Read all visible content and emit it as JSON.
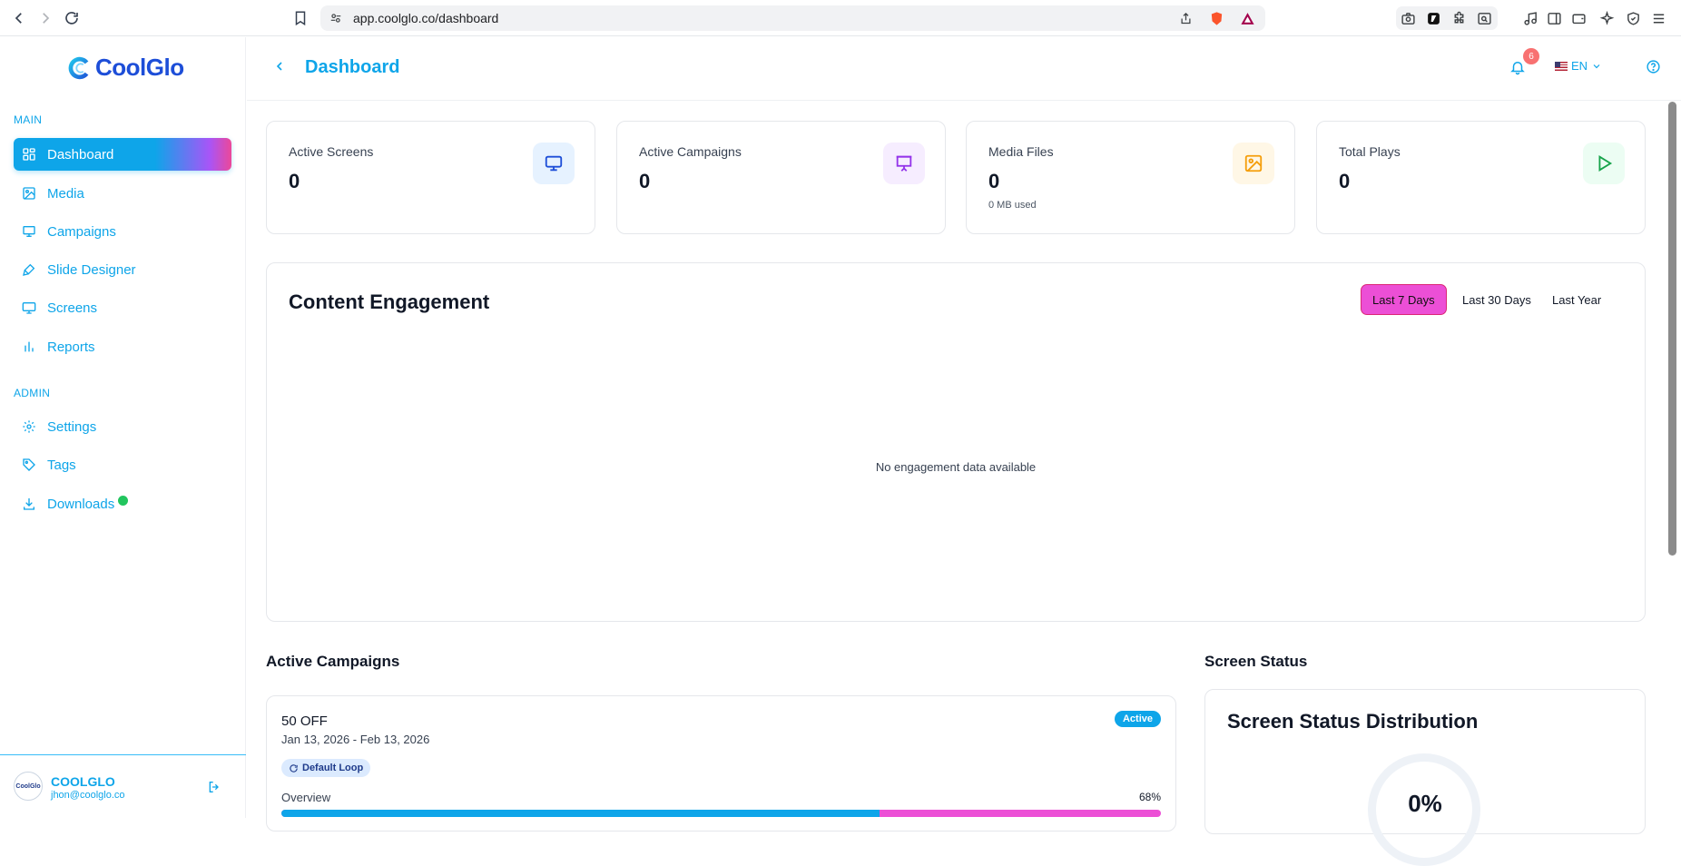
{
  "browser": {
    "url": "app.coolglo.co/dashboard"
  },
  "brand": {
    "name": "CoolGlo"
  },
  "header": {
    "title": "Dashboard",
    "notification_count": "6",
    "language": "EN"
  },
  "sidebar": {
    "main_label": "MAIN",
    "admin_label": "ADMIN",
    "main_items": [
      {
        "label": "Dashboard",
        "icon": "grid-icon"
      },
      {
        "label": "Media",
        "icon": "image-icon"
      },
      {
        "label": "Campaigns",
        "icon": "presentation-icon"
      },
      {
        "label": "Slide Designer",
        "icon": "brush-icon"
      },
      {
        "label": "Screens",
        "icon": "monitor-icon"
      },
      {
        "label": "Reports",
        "icon": "bar-chart-icon"
      }
    ],
    "admin_items": [
      {
        "label": "Settings",
        "icon": "gear-icon"
      },
      {
        "label": "Tags",
        "icon": "tag-icon"
      },
      {
        "label": "Downloads",
        "icon": "download-icon"
      }
    ],
    "user": {
      "name": "COOLGLO",
      "email": "jhon@coolglo.co",
      "avatar_text": "CoolGlo"
    }
  },
  "stats": [
    {
      "label": "Active Screens",
      "value": "0",
      "icon": "monitor-icon",
      "color": "#1d4ed8",
      "bg": "#e6f2ff"
    },
    {
      "label": "Active Campaigns",
      "value": "0",
      "icon": "presentation-icon",
      "color": "#9333ea",
      "bg": "#f6edff"
    },
    {
      "label": "Media Files",
      "value": "0",
      "sub": "0 MB used",
      "icon": "image-icon",
      "color": "#f59e0b",
      "bg": "#fff7e6"
    },
    {
      "label": "Total Plays",
      "value": "0",
      "icon": "play-icon",
      "color": "#16a34a",
      "bg": "#ecfdf3"
    }
  ],
  "engagement": {
    "title": "Content Engagement",
    "ranges": [
      "Last 7 Days",
      "Last 30 Days",
      "Last Year"
    ],
    "selected_range": "Last 7 Days",
    "empty_message": "No engagement data available"
  },
  "active_campaigns": {
    "title": "Active Campaigns",
    "items": [
      {
        "name": "50 OFF",
        "dates": "Jan 13, 2026 - Feb 13, 2026",
        "status": "Active",
        "loop": "Default Loop",
        "overview_label": "Overview",
        "overview_pct": "68%",
        "progress": 0.68
      }
    ]
  },
  "screen_status": {
    "title": "Screen Status",
    "card_title": "Screen Status Distribution",
    "percent": "0%"
  },
  "colors": {
    "accent": "#0ea5e9",
    "pink": "#ec4fd6",
    "success": "#22c55e"
  }
}
